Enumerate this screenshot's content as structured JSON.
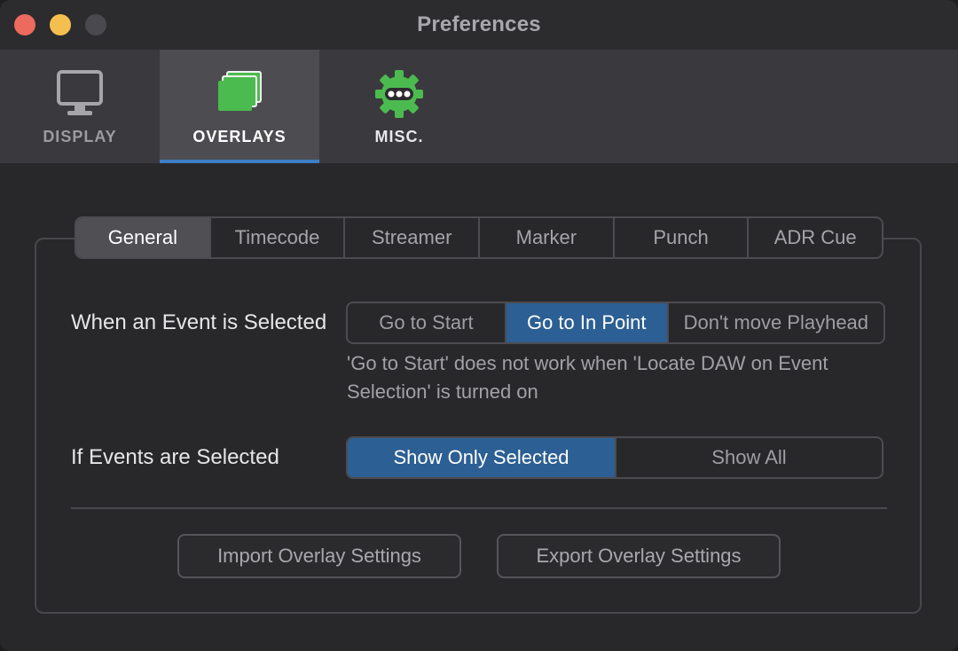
{
  "window": {
    "title": "Preferences"
  },
  "toolbar": {
    "items": [
      {
        "label": "DISPLAY",
        "icon": "monitor-icon"
      },
      {
        "label": "OVERLAYS",
        "icon": "overlays-icon",
        "active": true
      },
      {
        "label": "MISC.",
        "icon": "gear-icon"
      }
    ]
  },
  "tabs": {
    "items": [
      "General",
      "Timecode",
      "Streamer",
      "Marker",
      "Punch",
      "ADR Cue"
    ],
    "active": "General"
  },
  "event_selected": {
    "label": "When an Event is Selected",
    "options": [
      "Go to Start",
      "Go to In Point",
      "Don't move Playhead"
    ],
    "selected": "Go to In Point",
    "hint": "'Go to Start' does not work when 'Locate DAW on Event Selection' is turned on"
  },
  "events_selected": {
    "label": "If Events are Selected",
    "options": [
      "Show Only Selected",
      "Show All"
    ],
    "selected": "Show Only Selected"
  },
  "actions": {
    "import_label": "Import Overlay Settings",
    "export_label": "Export Overlay Settings"
  },
  "colors": {
    "accent": "#3d7fc6",
    "selected_segment": "#2c5f93",
    "icon_green": "#4cbb4f"
  }
}
